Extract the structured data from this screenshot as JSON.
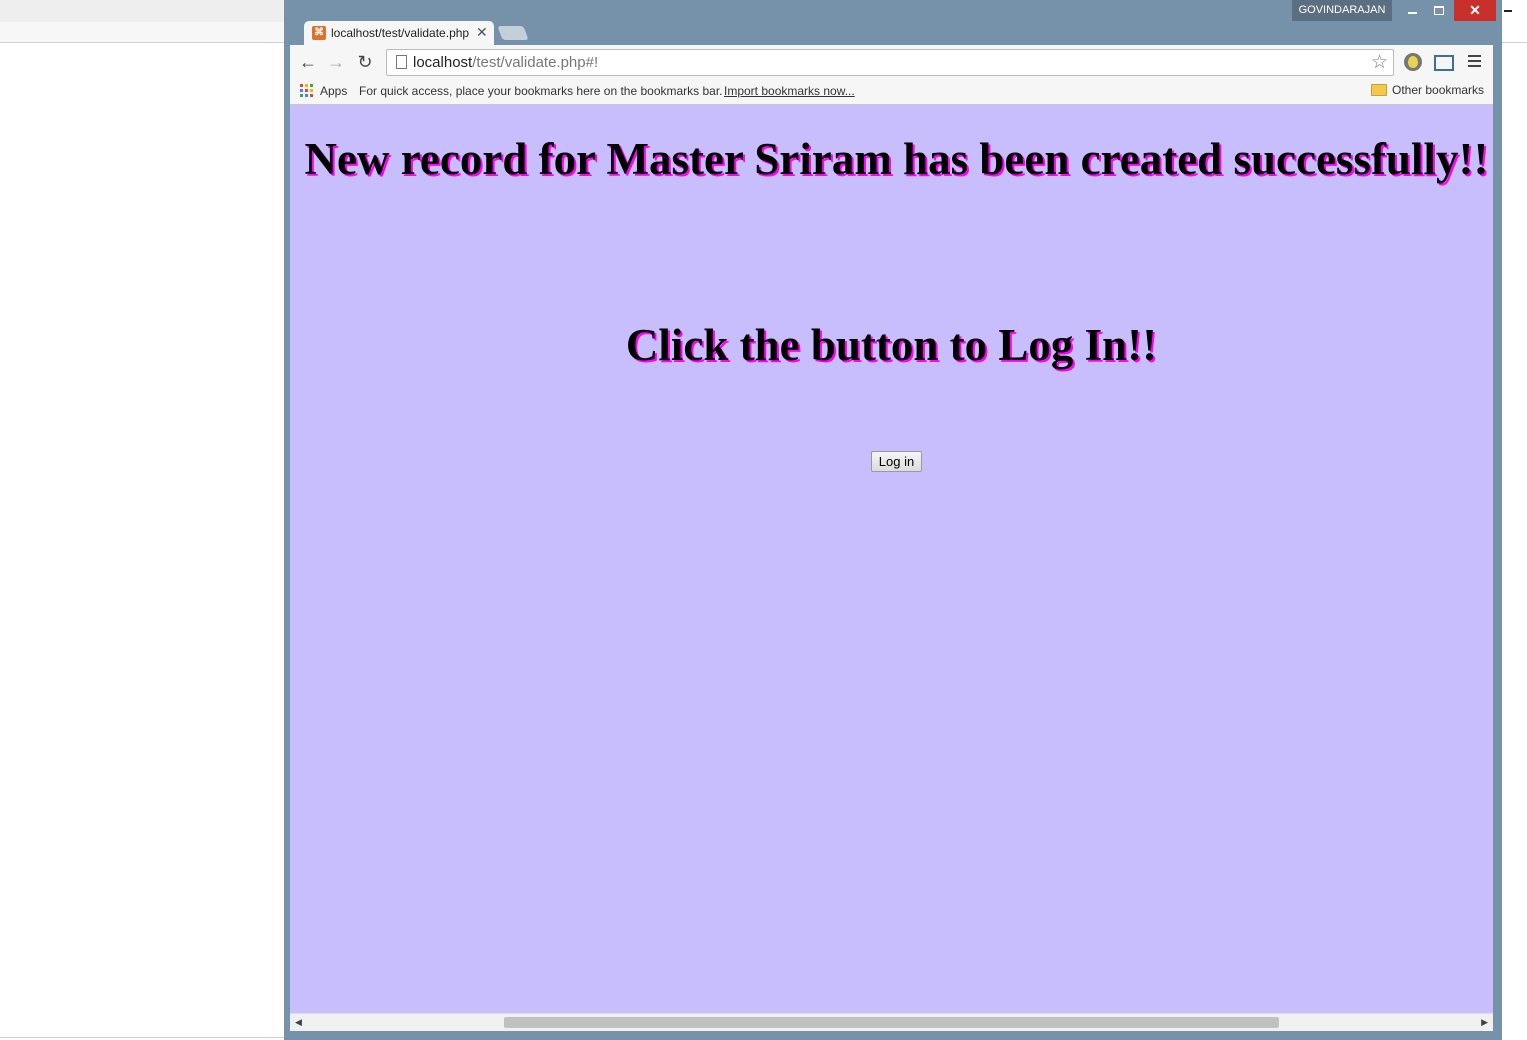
{
  "window": {
    "profile_name": "GOVINDARAJAN",
    "close_glyph": "✕",
    "frame_color": "#7592aa"
  },
  "tab": {
    "title": "localhost/test/validate.php#!",
    "close_glyph": "✕",
    "favicon": "xampp-icon"
  },
  "toolbar": {
    "back_glyph": "←",
    "forward_glyph": "→",
    "reload_glyph": "↻",
    "url_host": "localhost",
    "url_path": "/test/validate.php#!",
    "star_glyph": "☆"
  },
  "bookmarks": {
    "apps_label": "Apps",
    "hint": "For quick access, place your bookmarks here on the bookmarks bar.",
    "import_link": "Import bookmarks now...",
    "other_label": "Other bookmarks"
  },
  "page": {
    "heading_success": "New record for Master Sriram has been created successfully!!",
    "heading_click": "Click the button to Log In!!",
    "login_button": "Log in",
    "background_color": "#c8bdfd",
    "shadow_color": "#ff00ff"
  },
  "scrollbar": {
    "left_glyph": "◀",
    "right_glyph": "▶"
  }
}
